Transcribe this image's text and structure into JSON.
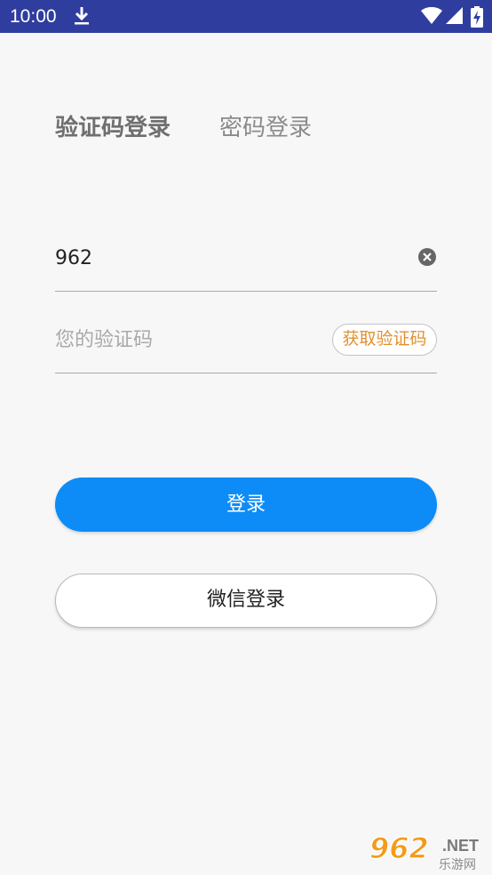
{
  "status_bar": {
    "time": "10:00",
    "icons": [
      "download-icon",
      "wifi-icon",
      "signal-icon",
      "battery-charging-icon"
    ],
    "background": "#2f3e9e"
  },
  "tabs": [
    {
      "label": "验证码登录",
      "active": true
    },
    {
      "label": "密码登录",
      "active": false
    }
  ],
  "phone_field": {
    "value": "962",
    "clear_icon": "clear-icon"
  },
  "code_field": {
    "placeholder": "您的验证码",
    "get_code_label": "获取验证码"
  },
  "buttons": {
    "login_label": "登录",
    "wechat_label": "微信登录"
  },
  "watermark": {
    "logo": "962",
    "suffix": ".NET",
    "caption": "乐游网"
  },
  "colors": {
    "accent": "#0d8cf7",
    "code_button_text": "#e0912e",
    "watermark": "#f49a1a"
  }
}
